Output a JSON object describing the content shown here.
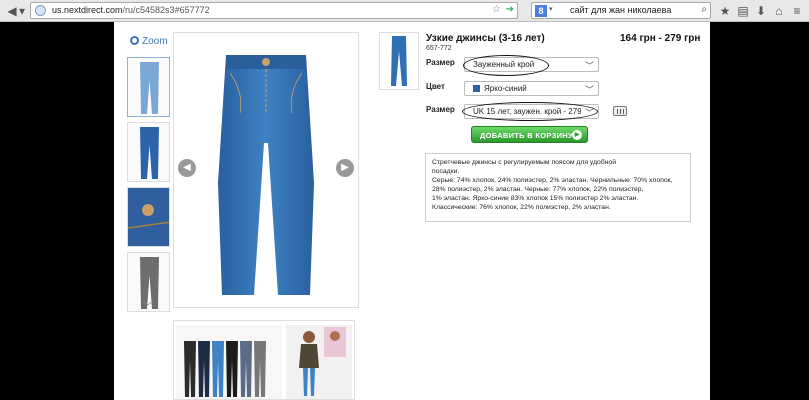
{
  "browser": {
    "url_host": "us.nextdirect.com",
    "url_path": "/ru/c54582s3#657772",
    "search_query": "сайт для жан николаева",
    "search_engine_letter": "8"
  },
  "gallery": {
    "zoom_label": "Zoom",
    "prev_icon": "chevron-left-icon",
    "next_icon": "chevron-right-icon",
    "thumbs_down_icon": "chevron-down-icon"
  },
  "product": {
    "title": "Узкие джинсы (3-16 лет)",
    "code": "657-772",
    "price": "164 грн - 279 грн",
    "size_label": "Размер",
    "fit_value": "Зауженный крой",
    "color_label": "Цвет",
    "color_value": "Ярко-синий",
    "size_label_2": "Размер",
    "size_value": "UK 15 лет, заужен. крой - 279 гр",
    "add_to_cart": "ДОБАВИТЬ В КОРЗИНУ",
    "description": [
      "Стретчевые джинсы с регулируемым поясом для удобной",
      "посадки.",
      "Серые: 74% хлопок, 24% полиэстер, 2% эластан. Чернильные: 70% хлопок,",
      "28% полиэстер, 2% эластан. Черные: 77% хлопок, 22% полиэстер,",
      "1% эластан. Ярко-синие 83% хлопок 15% полиэстер 2% эластан.",
      "Классические: 76% хлопок, 22% полиэстер, 2% эластан."
    ]
  },
  "colors": {
    "denim": "#2f6fb3",
    "button_green": "#2a9a2a",
    "link_blue": "#3b76b8"
  }
}
